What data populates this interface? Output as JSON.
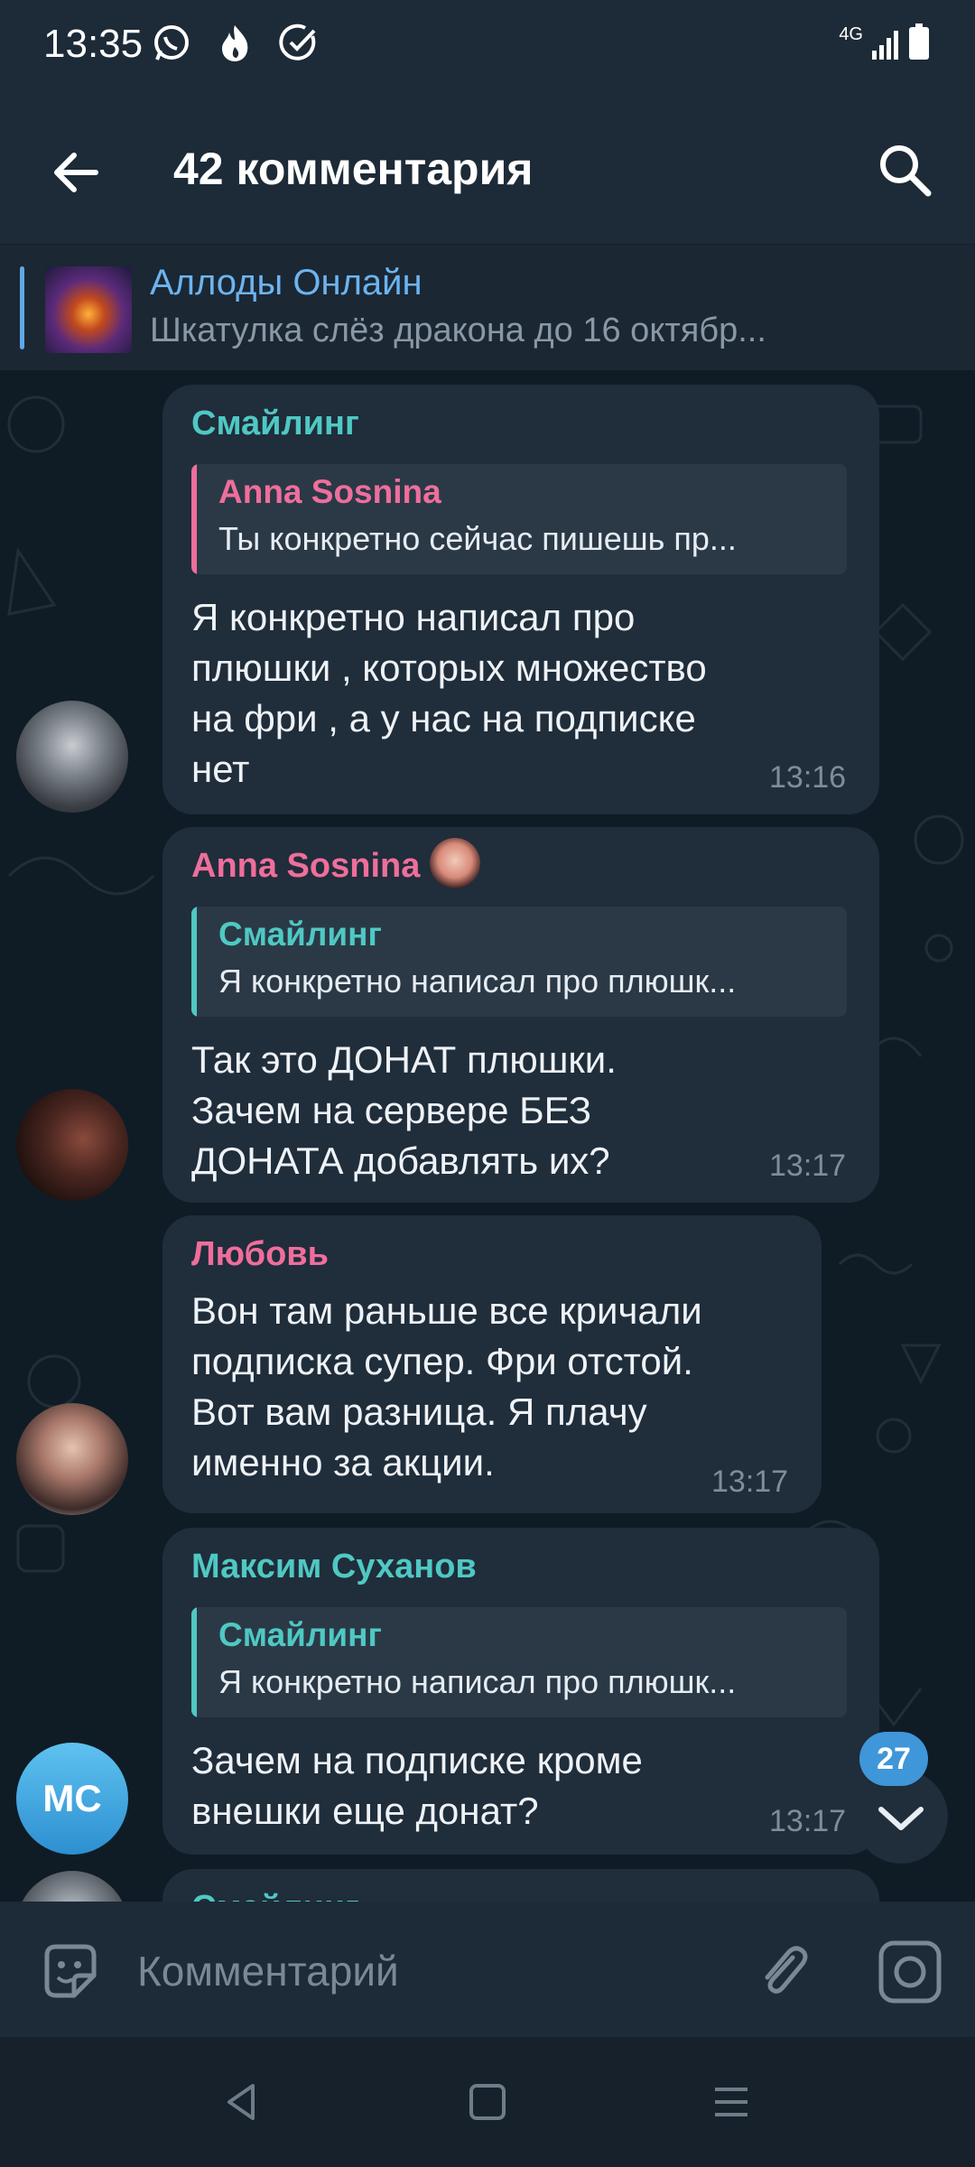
{
  "status_bar": {
    "time": "13:35",
    "network": "4G",
    "icons": [
      "whatsapp-icon",
      "flame-icon",
      "check-circle-icon",
      "signal-icon",
      "battery-icon"
    ]
  },
  "header": {
    "title": "42 комментария",
    "icons": [
      "back-arrow-icon",
      "search-icon"
    ]
  },
  "pinned": {
    "title": "Аллоды Онлайн",
    "subtitle": "Шкатулка слёз дракона до 16 октябр..."
  },
  "messages": [
    {
      "author": "Смайлинг",
      "author_color": "#4fc8c3",
      "reply": {
        "author": "Anna Sosnina",
        "text": "Ты конкретно сейчас пишешь пр...",
        "color": "#ee6e9c"
      },
      "text": "Я конкретно написал про\nплюшки , которых множество\nна фри , а у нас на подписке\nнет",
      "time": "13:16"
    },
    {
      "author": "Anna Sosnina",
      "author_color": "#ee6e9c",
      "reply": {
        "author": "Смайлинг",
        "text": "Я конкретно написал про плюшк...",
        "color": "#4fc8c3"
      },
      "text": "Так это ДОНАТ плюшки.\nЗачем на сервере БЕЗ\nДОНАТА добавлять их?",
      "time": "13:17"
    },
    {
      "author": "Любовь",
      "author_color": "#ee6e9c",
      "text": "Вон там раньше все кричали\nподписка супер. Фри отстой.\nВот вам разница. Я плачу\nименно за акции.",
      "time": "13:17"
    },
    {
      "author": "Максим Суханов",
      "author_color": "#4fc8c3",
      "avatar_initials": "МС",
      "reply": {
        "author": "Смайлинг",
        "text": "Я конкретно написал про плюшк...",
        "color": "#4fc8c3"
      },
      "text": "Зачем на подписке кроме\nвнешки еще донат?",
      "time": "13:17"
    },
    {
      "author": "Смайлинг",
      "author_color": "#4fc8c3"
    }
  ],
  "scroll": {
    "unread_count": "27"
  },
  "input": {
    "placeholder": "Комментарий"
  },
  "colors": {
    "accent": "#3f96d8",
    "bubble": "#202d3a",
    "background": "#0f1c26",
    "teal": "#4fc8c3",
    "pink": "#ee6e9c"
  }
}
